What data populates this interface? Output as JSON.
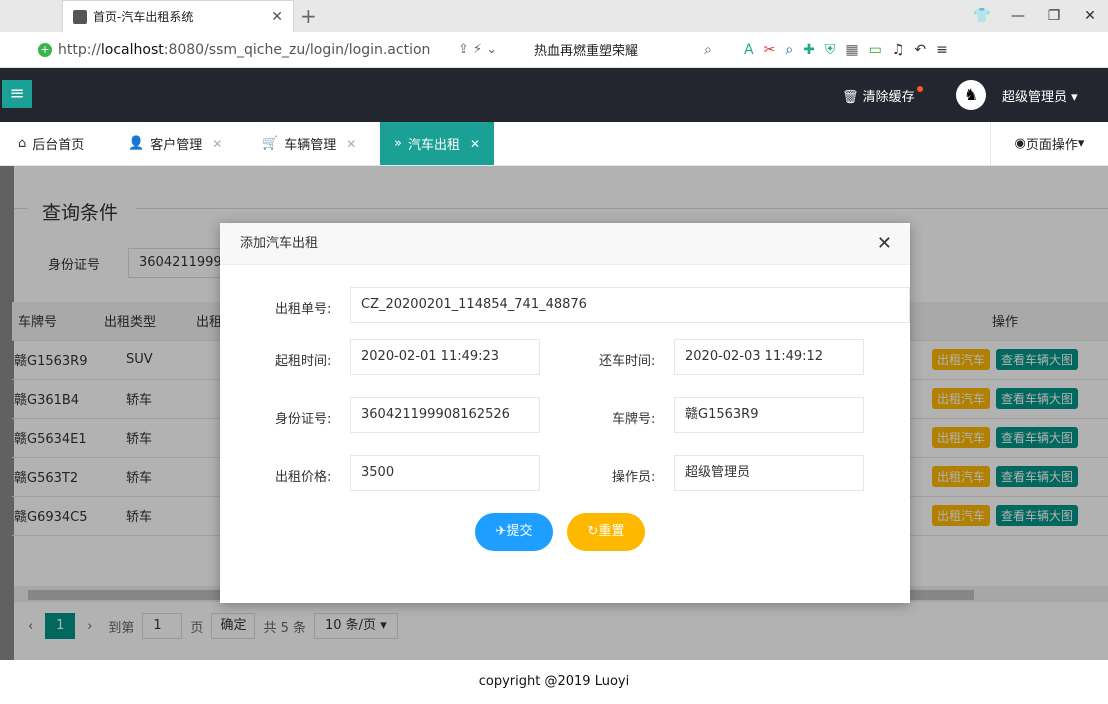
{
  "browser": {
    "tab_title": "首页-汽车出租系统",
    "new_tab": "+",
    "url_prefix": "http://",
    "url_host": "localhost",
    "url_rest": ":8080/ssm_qiche_zu/login/login.action",
    "search_query": "热血再燃重塑荣耀"
  },
  "header": {
    "clear_cache": "清除缓存",
    "user_name": "超级管理员"
  },
  "tabs": [
    {
      "label": "后台首页"
    },
    {
      "label": "客户管理"
    },
    {
      "label": "车辆管理"
    },
    {
      "label": "汽车出租"
    }
  ],
  "page_ops": "页面操作",
  "query": {
    "title": "查询条件",
    "id_label": "身份证号",
    "id_value": "36042119990"
  },
  "table": {
    "headers": [
      "车牌号",
      "出租类型",
      "出租",
      "操作"
    ],
    "rows": [
      {
        "plate": "赣G1563R9",
        "type": "SUV"
      },
      {
        "plate": "赣G361B4",
        "type": "轿车"
      },
      {
        "plate": "赣G5634E1",
        "type": "轿车"
      },
      {
        "plate": "赣G563T2",
        "type": "轿车"
      },
      {
        "plate": "赣G6934C5",
        "type": "轿车"
      }
    ],
    "btn_rent": "出租汽车",
    "btn_view": "查看车辆大图"
  },
  "pager": {
    "current": "1",
    "goto_label": "到第",
    "goto_value": "1",
    "page_unit": "页",
    "confirm": "确定",
    "total": "共 5 条",
    "page_size": "10 条/页"
  },
  "footer": "copyright @2019 Luoyi",
  "modal": {
    "title": "添加汽车出租",
    "order_label": "出租单号:",
    "order_value": "CZ_20200201_114854_741_48876",
    "start_label": "起租时间:",
    "start_value": "2020-02-01 11:49:23",
    "return_label": "还车时间:",
    "return_value": "2020-02-03 11:49:12",
    "id_label": "身份证号:",
    "id_value": "360421199908162526",
    "plate_label": "车牌号:",
    "plate_value": "赣G1563R9",
    "price_label": "出租价格:",
    "price_value": "3500",
    "operator_label": "操作员:",
    "operator_value": "超级管理员",
    "submit": "提交",
    "reset": "重置"
  }
}
